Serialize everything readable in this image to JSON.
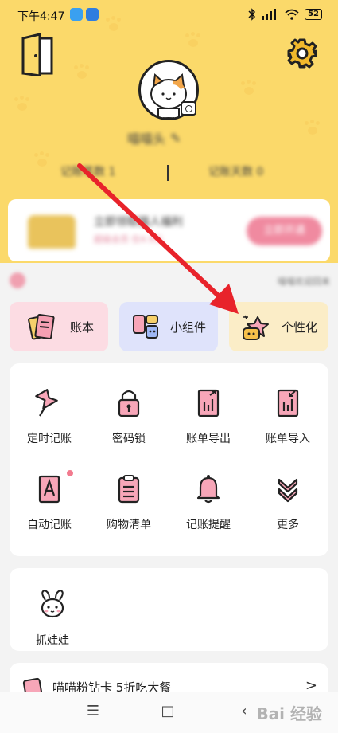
{
  "status": {
    "time": "下午4:47",
    "battery": "52"
  },
  "profile": {
    "name": "喵喵头",
    "stat_left": "记账笔数 1",
    "stat_right": "记账天数 0"
  },
  "vip": {
    "title": "立即领取猫人福利",
    "subtitle": "超级会员 仅4.9元",
    "button": "立即开通"
  },
  "notice": {
    "text": "喵喵欢迎回来"
  },
  "quick": [
    {
      "label": "账本",
      "icon": "ledger-book-icon",
      "bg": "#fcdce3"
    },
    {
      "label": "小组件",
      "icon": "widget-icon",
      "bg": "#dfe3fb"
    },
    {
      "label": "个性化",
      "icon": "magic-wand-icon",
      "bg": "#fbedc7"
    }
  ],
  "tools": [
    {
      "label": "定时记账",
      "icon": "pin-icon"
    },
    {
      "label": "密码锁",
      "icon": "lock-icon"
    },
    {
      "label": "账单导出",
      "icon": "export-icon"
    },
    {
      "label": "账单导入",
      "icon": "import-icon"
    },
    {
      "label": "自动记账",
      "icon": "auto-record-icon"
    },
    {
      "label": "购物清单",
      "icon": "shopping-list-icon"
    },
    {
      "label": "记账提醒",
      "icon": "bell-icon"
    },
    {
      "label": "更多",
      "icon": "chevron-double-down-icon"
    }
  ],
  "extra": {
    "label": "抓娃娃",
    "icon": "bunny-icon"
  },
  "promo": {
    "text": "喵喵粉钻卡 5折吃大餐",
    "arrow": ">"
  },
  "nav": {
    "menu": "☰",
    "home": "□",
    "back": "‹"
  },
  "watermark": "Bai 经验",
  "colors": {
    "header_bg": "#fbd96a",
    "accent_pink": "#f08aa0",
    "arrow_red": "#e8232b"
  }
}
